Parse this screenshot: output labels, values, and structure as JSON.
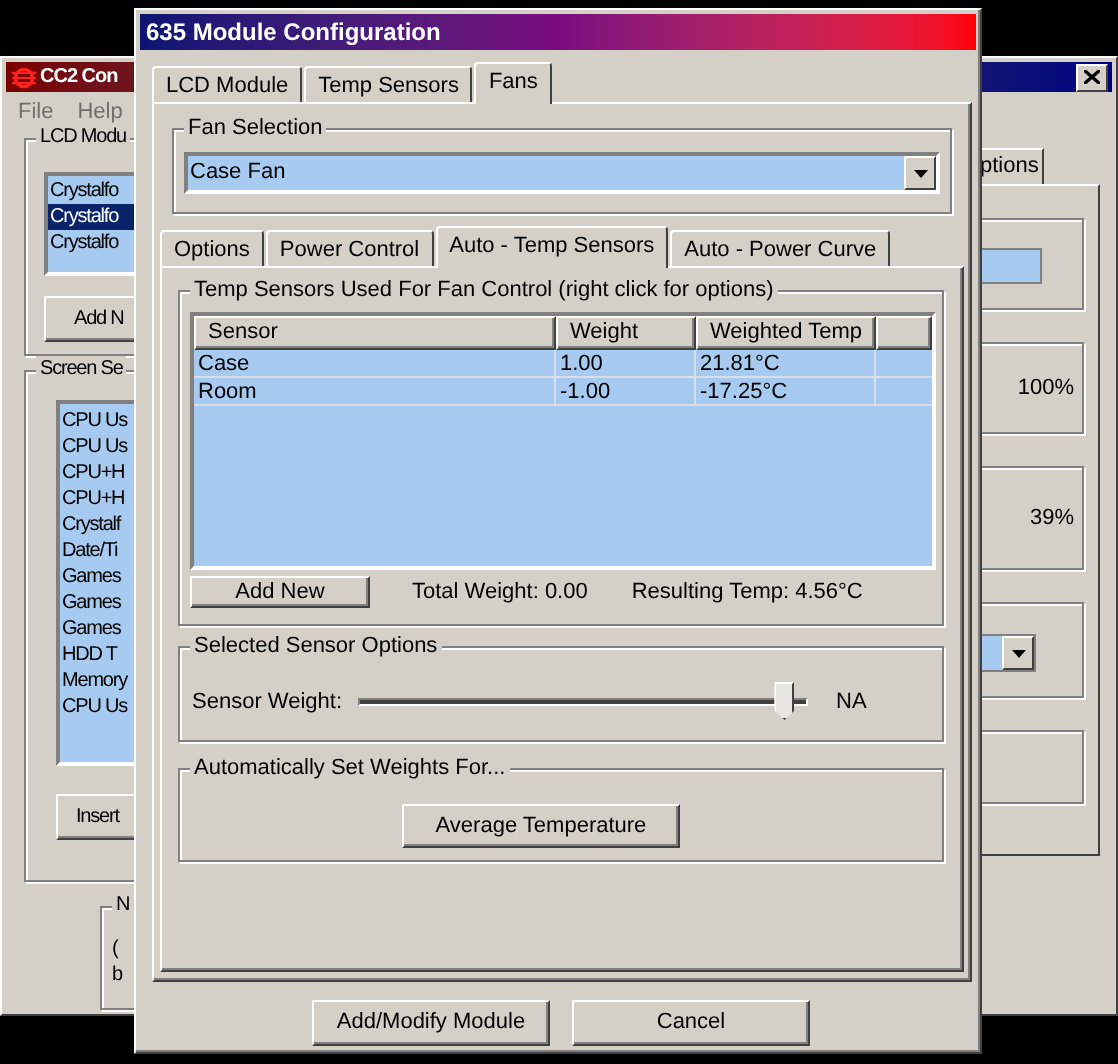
{
  "back_window": {
    "title": "CC2 Con",
    "menu": [
      "File",
      "Help"
    ],
    "lcd_group": {
      "label": "LCD Modu",
      "items": [
        {
          "text": "Crystalfo",
          "selected": false
        },
        {
          "text": "Crystalfo",
          "selected": true
        },
        {
          "text": "Crystalfo",
          "selected": false
        }
      ],
      "button": "Add N"
    },
    "screen_group": {
      "label": "Screen Se",
      "items": [
        "CPU Us",
        "CPU Us",
        "CPU+H",
        "CPU+H",
        "Crystalf",
        "Date/Ti",
        "Games",
        "Games",
        "Games",
        "HDD T",
        "Memory",
        "CPU Us"
      ],
      "button": "Insert"
    },
    "bottom_group": {
      "label": "N",
      "lines": [
        "(",
        "b"
      ]
    },
    "tab": "ptions",
    "readings": [
      "100%",
      "39%"
    ]
  },
  "dialog": {
    "title": "635 Module Configuration",
    "tabs": [
      {
        "label": "LCD Module",
        "selected": false
      },
      {
        "label": "Temp Sensors",
        "selected": false
      },
      {
        "label": "Fans",
        "selected": true
      }
    ],
    "fan_selection": {
      "label": "Fan Selection",
      "value": "Case Fan"
    },
    "subtabs": [
      {
        "label": "Options",
        "selected": false
      },
      {
        "label": "Power Control",
        "selected": false
      },
      {
        "label": "Auto - Temp Sensors",
        "selected": true
      },
      {
        "label": "Auto - Power Curve",
        "selected": false
      }
    ],
    "sensors_group": {
      "label": "Temp Sensors Used For Fan Control (right click for options)",
      "columns": [
        "Sensor",
        "Weight",
        "Weighted Temp"
      ],
      "rows": [
        [
          "Case",
          "1.00",
          "21.81°C"
        ],
        [
          "Room",
          "-1.00",
          "-17.25°C"
        ]
      ],
      "button": "Add New",
      "total_weight": "Total Weight: 0.00",
      "resulting_temp": "Resulting Temp: 4.56°C"
    },
    "options_group": {
      "label": "Selected Sensor Options",
      "slider_label": "Sensor Weight:",
      "level": 0.97,
      "reading": "NA"
    },
    "auto_group": {
      "label": "Automatically Set Weights For...",
      "button": "Average Temperature"
    },
    "buttons": [
      "Add/Modify Module",
      "Cancel"
    ]
  }
}
